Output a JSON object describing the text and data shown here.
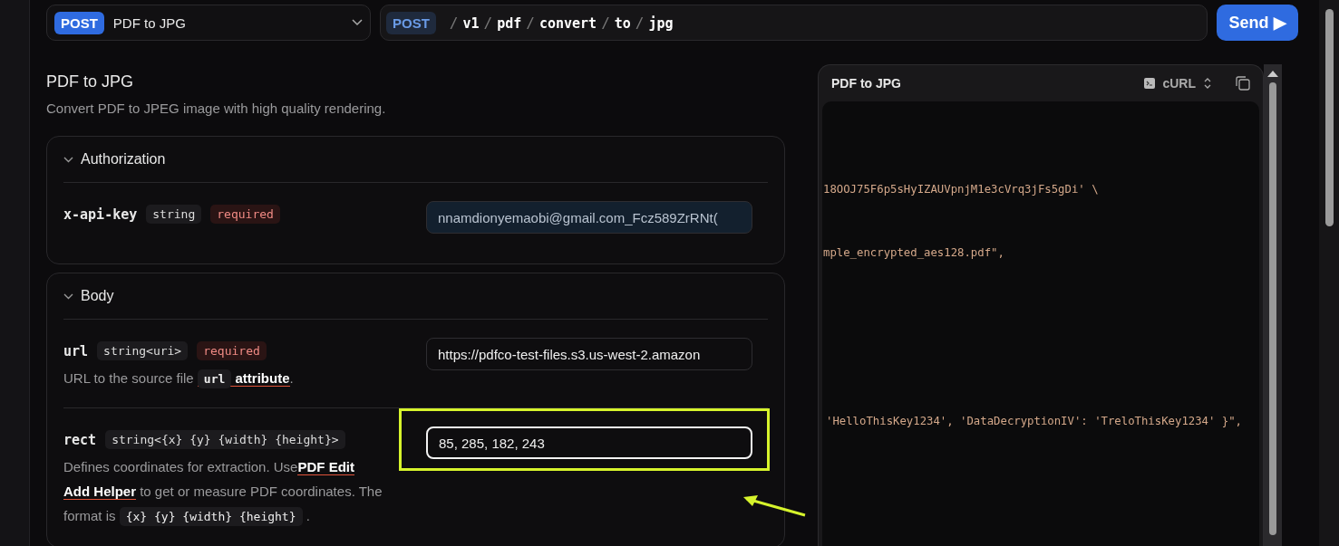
{
  "endpoint_select": {
    "method": "POST",
    "title": "PDF to JPG"
  },
  "url_bar": {
    "method": "POST",
    "segments": [
      {
        "sep": "/",
        "text": "v1"
      },
      {
        "sep": "/",
        "text": "pdf"
      },
      {
        "sep": "/",
        "text": "convert"
      },
      {
        "sep": "/",
        "text": "to"
      },
      {
        "sep": "/",
        "text": "jpg"
      }
    ]
  },
  "send_button": {
    "label": "Send",
    "icon": "▶"
  },
  "page": {
    "title": "PDF to JPG",
    "description": "Convert PDF to JPEG image with high quality rendering."
  },
  "sections": [
    {
      "title": "Authorization",
      "expanded": true,
      "params": [
        {
          "name": "x-api-key",
          "type": "string",
          "required_label": "required",
          "value": "nnamdionyemaobi@gmail.com_Fcz589ZrRNt(",
          "highlighted": false
        }
      ]
    },
    {
      "title": "Body",
      "expanded": true,
      "params": [
        {
          "name": "url",
          "type": "string<uri>",
          "required_label": "required",
          "value": "https://pdfco-test-files.s3.us-west-2.amazon",
          "highlighted": false,
          "description": [
            {
              "kind": "text",
              "text": "URL to the source file "
            },
            {
              "kind": "link",
              "code": "url",
              "text": "attribute"
            },
            {
              "kind": "text",
              "text": "."
            }
          ]
        },
        {
          "name": "rect",
          "type": "string<{x} {y} {width} {height}>",
          "value": "85, 285, 182, 243",
          "highlighted": true,
          "description": [
            {
              "kind": "text",
              "text": "Defines coordinates for extraction. Use"
            },
            {
              "kind": "link",
              "text": "PDF Edit"
            },
            {
              "kind": "link",
              "text": "Add Helper"
            },
            {
              "kind": "text",
              "text": " to get or measure PDF coordinates. The format is "
            },
            {
              "kind": "code",
              "text": "{x} {y} {width} {height}"
            },
            {
              "kind": "text",
              "text": " ."
            }
          ]
        }
      ]
    }
  ],
  "code_panel": {
    "title": "PDF to JPG",
    "language": "cURL",
    "lines": [
      "18OOJ75F6p5sHyIZAUVpnjM1e3cVrq3jFs5gDi' \\",
      "mple_encrypted_aes128.pdf\",",
      "'HelloThisKey1234', 'DataDecryptionIV': 'TreloThisKey1234' }\","
    ]
  }
}
